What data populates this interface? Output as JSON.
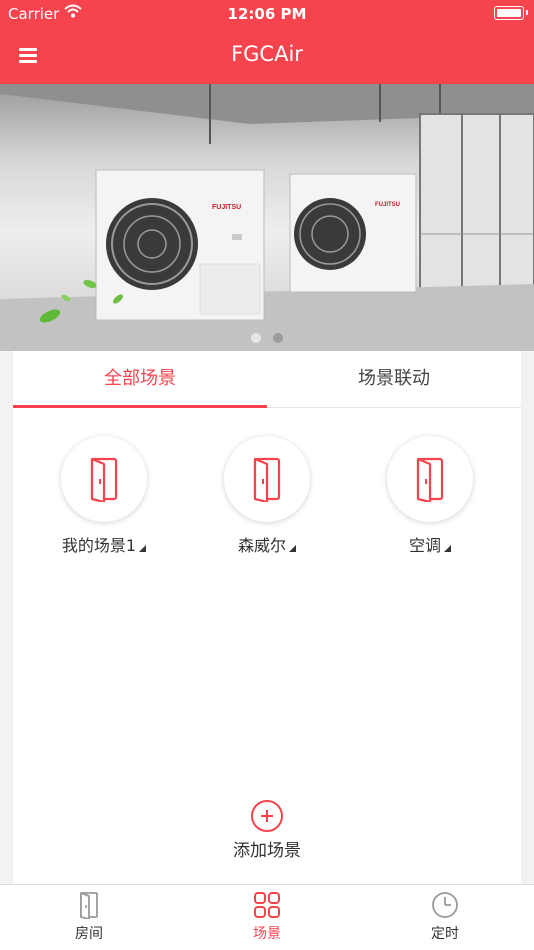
{
  "status_bar": {
    "carrier": "Carrier",
    "time": "12:06 PM"
  },
  "nav": {
    "title": "FGCAir",
    "menu_icon": "hamburger-menu-icon"
  },
  "banner": {
    "image": "air-conditioner-outdoor-units-photo",
    "brand_text": "FUJITSU",
    "page_count": 2,
    "active_page": 2
  },
  "tabs": [
    {
      "label": "全部场景",
      "active": true
    },
    {
      "label": "场景联动",
      "active": false
    }
  ],
  "scenes": [
    {
      "label": "我的场景1",
      "icon": "door-icon"
    },
    {
      "label": "森威尔",
      "icon": "door-icon"
    },
    {
      "label": "空调",
      "icon": "door-icon"
    }
  ],
  "add_scene": {
    "label": "添加场景",
    "icon": "plus-circle-icon"
  },
  "tab_bar": [
    {
      "label": "房间",
      "icon": "door-icon",
      "active": false
    },
    {
      "label": "场景",
      "icon": "grid-icon",
      "active": true
    },
    {
      "label": "定时",
      "icon": "clock-icon",
      "active": false
    }
  ],
  "colors": {
    "accent": "#f6444e",
    "text": "#333333",
    "inactive_icon": "#9a9a9a"
  }
}
